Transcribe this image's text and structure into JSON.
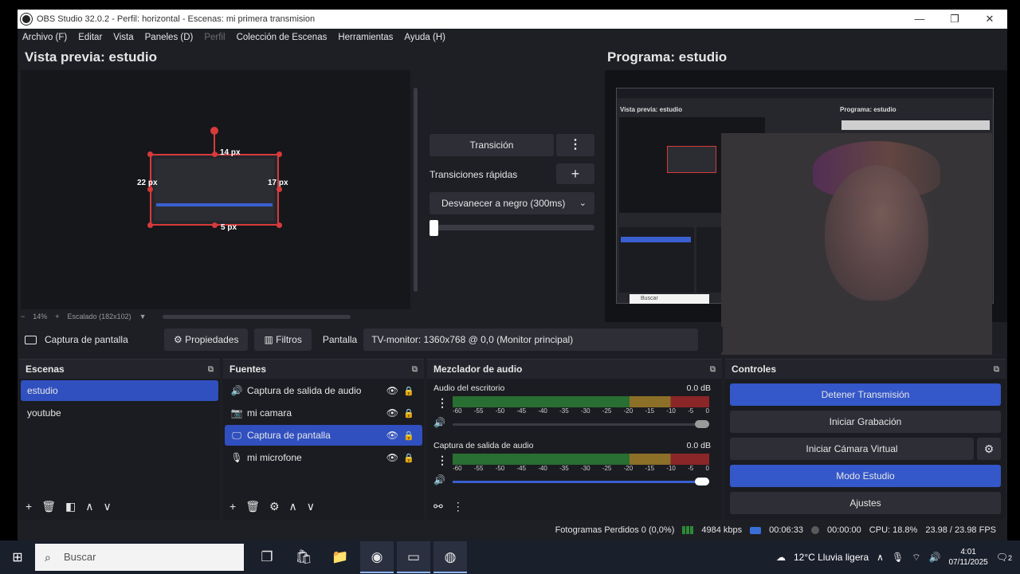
{
  "window": {
    "title": "OBS Studio 32.0.2 - Perfil: horizontal - Escenas: mi primera transmision",
    "minimize": "—",
    "maximize": "❐",
    "close": "✕"
  },
  "menu": [
    "Archivo (F)",
    "Editar",
    "Vista",
    "Paneles (D)",
    "Perfil",
    "Colección de Escenas",
    "Herramientas",
    "Ayuda (H)"
  ],
  "menu_disabled_index": 4,
  "preview": {
    "title": "Vista previa: estudio",
    "px_top": "14 px",
    "px_left": "22 px",
    "px_right": "17 px",
    "px_bottom": "5 px",
    "zoom_minus": "−",
    "zoom": "14%",
    "zoom_plus": "+",
    "scale_label": "Escalado (182x102)"
  },
  "program": {
    "title": "Programa: estudio",
    "mini_preview_title": "Vista previa: estudio",
    "mini_program_title": "Programa: estudio",
    "mini_search": "Buscar"
  },
  "transition": {
    "button": "Transición",
    "more": "⋮",
    "quick_label": "Transiciones rápidas",
    "add": "+",
    "selected": "Desvanecer a negro (300ms)",
    "chevron": "⌄",
    "slider_position": 0
  },
  "source_bar": {
    "selected_source": "Captura de pantalla",
    "properties": "Propiedades",
    "filters": "Filtros",
    "display_label": "Pantalla",
    "display_value": "TV-monitor: 1360x768 @ 0,0 (Monitor principal)"
  },
  "scenes": {
    "header": "Escenas",
    "items": [
      "estudio",
      "youtube"
    ],
    "active_index": 0
  },
  "sources": {
    "header": "Fuentes",
    "items": [
      {
        "icon": "speaker-icon",
        "glyph": "🔊",
        "label": "Captura de salida de audio"
      },
      {
        "icon": "camera-icon",
        "glyph": "📷",
        "label": "mi camara"
      },
      {
        "icon": "monitor-icon",
        "glyph": "🖵",
        "label": "Captura de pantalla"
      },
      {
        "icon": "microphone-icon",
        "glyph": "🎙",
        "label": "mi microfone"
      }
    ],
    "active_index": 2
  },
  "mixer": {
    "header": "Mezclador de audio",
    "channels": [
      {
        "name": "Audio del escritorio",
        "level": "0.0 dB",
        "volume_active": false
      },
      {
        "name": "Captura de salida de audio",
        "level": "0.0 dB",
        "volume_active": true
      }
    ],
    "ticks": [
      "-60",
      "-55",
      "-50",
      "-45",
      "-40",
      "-35",
      "-30",
      "-25",
      "-20",
      "-15",
      "-10",
      "-5",
      "0"
    ]
  },
  "controls": {
    "header": "Controles",
    "stop_stream": "Detener Transmisión",
    "start_recording": "Iniciar Grabación",
    "start_virtual_cam": "Iniciar Cámara Virtual",
    "studio_mode": "Modo Estudio",
    "settings": "Ajustes"
  },
  "status": {
    "dropped_frames": "Fotogramas Perdidos 0 (0,0%)",
    "bitrate": "4984 kbps",
    "stream_time": "00:06:33",
    "record_time": "00:00:00",
    "cpu": "CPU: 18.8%",
    "fps": "23.98 / 23.98 FPS"
  },
  "taskbar": {
    "search": "Buscar",
    "weather": "12°C  Lluvia ligera",
    "time": "4:01",
    "date": "07/11/2025",
    "notifications": "2"
  },
  "colors": {
    "accent": "#3457c9",
    "selection": "#d73a3a",
    "meter_green": "#2e8a38",
    "meter_yellow": "#b28c2a",
    "meter_red": "#b02a2a"
  }
}
